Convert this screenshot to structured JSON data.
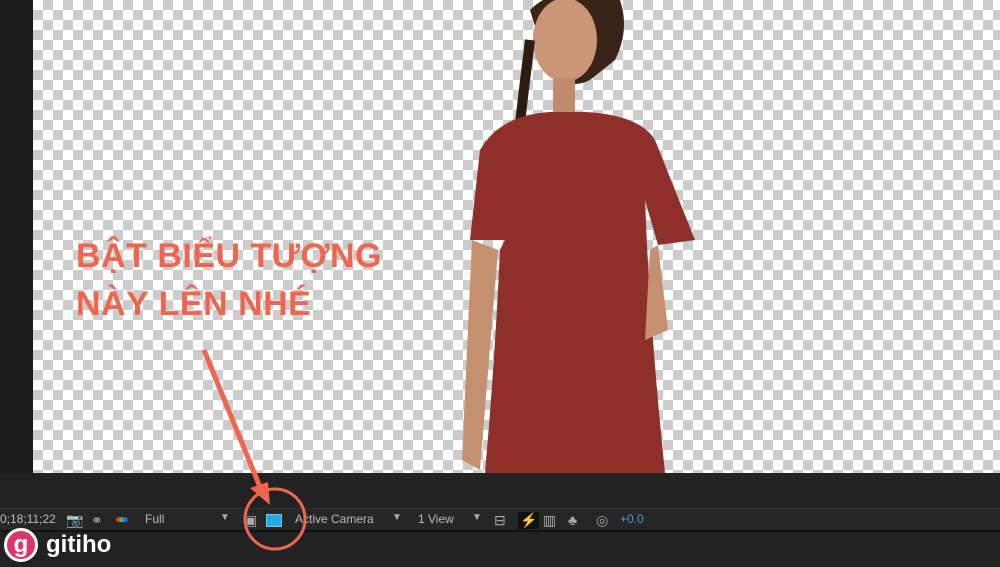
{
  "annotation": {
    "line1": "BẬT BIỂU TƯỢNG",
    "line2": "NÀY LÊN NHÉ",
    "color": "#f0654e"
  },
  "toolbar": {
    "timecode": "0;18;11;22",
    "resolution": "Full",
    "camera": "Active Camera",
    "views": "1 View",
    "exposure": "+0.0"
  },
  "brand": {
    "name": "gitiho",
    "logo_letter": "g"
  }
}
